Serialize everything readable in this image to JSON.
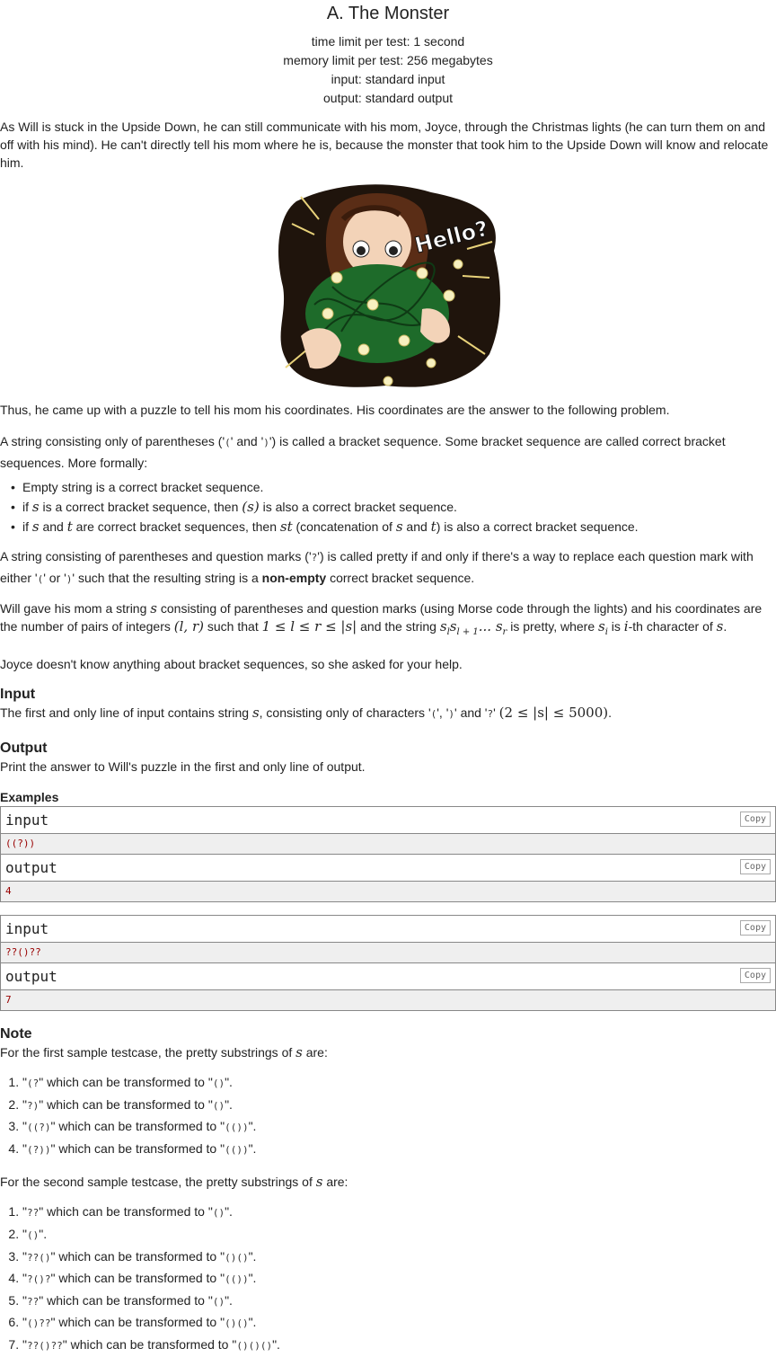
{
  "header": {
    "title": "A. The Monster",
    "time_limit": "time limit per test: 1 second",
    "memory_limit": "memory limit per test: 256 megabytes",
    "input": "input: standard input",
    "output": "output: standard output"
  },
  "statement": {
    "p1": "As Will is stuck in the Upside Down, he can still communicate with his mom, Joyce, through the Christmas lights (he can turn them on and off with his mind). He can't directly tell his mom where he is, because the monster that took him to the Upside Down will know and relocate him.",
    "image_text": "Hello?",
    "p2": "Thus, he came up with a puzzle to tell his mom his coordinates. His coordinates are the answer to the following problem.",
    "p3a": "A string consisting only of parentheses ('",
    "p3b": "' and '",
    "p3c": "') is called a bracket sequence. Some bracket sequence are called correct bracket sequences. More formally:",
    "paren_open": "(",
    "paren_close": ")",
    "b1": "Empty string is a correct bracket sequence.",
    "b2a": "if ",
    "b2b": " is a correct bracket sequence, then ",
    "b2c": " is also a correct bracket sequence.",
    "b3a": "if ",
    "b3b": " and ",
    "b3c": " are correct bracket sequences, then ",
    "b3d": " (concatenation of ",
    "b3e": " and ",
    "b3f": ") is also a correct bracket sequence.",
    "p4a": "A string consisting of parentheses and question marks ('",
    "p4b": "') is called pretty if and only if there's a way to replace each question mark with either '",
    "p4c": "' or '",
    "p4d": "' such that the resulting string is a ",
    "p4bold": "non-empty",
    "p4e": " correct bracket sequence.",
    "qmark": "?",
    "p5a": "Will gave his mom a string ",
    "p5b": " consisting of parentheses and question marks (using Morse code through the lights) and his coordinates are the number of pairs of integers ",
    "p5c": " such that ",
    "p5d": " and the string ",
    "p5e": " is pretty, where ",
    "p5f": " is ",
    "p5g": "-th character of ",
    "p5h": ".",
    "p6": "Joyce doesn't know anything about bracket sequences, so she asked for your help."
  },
  "math": {
    "s": "s",
    "t": "t",
    "st": "st",
    "i": "i",
    "paren_s": "(s)",
    "lr": "(l, r)",
    "ineq": "1 ≤ l ≤ r ≤ |s|",
    "substr": "s",
    "substr_sub1": "l",
    "substr_mid": "s",
    "substr_sub2": "l + 1",
    "substr_dots": "... s",
    "substr_sub3": "r",
    "si": "s",
    "si_sub": "i",
    "len_bound": "(2 ≤ |s| ≤ 5000)"
  },
  "input_section": {
    "title": "Input",
    "a": "The first and only line of input contains string ",
    "b": ", consisting only of characters '",
    "c": "', '",
    "d": "' and '",
    "e": "' ",
    "f": "."
  },
  "output_section": {
    "title": "Output",
    "text": "Print the answer to Will's puzzle in the first and only line of output."
  },
  "examples": {
    "title": "Examples",
    "input_label": "input",
    "output_label": "output",
    "copy_label": "Copy",
    "ex1_in": "((?))",
    "ex1_out": "4",
    "ex2_in": "??()??",
    "ex2_out": "7"
  },
  "note": {
    "title": "Note",
    "first_intro_a": "For the first sample testcase, the pretty substrings of ",
    "first_intro_b": " are:",
    "second_intro_a": "For the second sample testcase, the pretty substrings of ",
    "second_intro_b": " are:",
    "transform": "\" which can be transformed to \"",
    "first": [
      {
        "from": "(?",
        "to": "()"
      },
      {
        "from": "?)",
        "to": "()"
      },
      {
        "from": "((?)",
        "to": "(())"
      },
      {
        "from": "(?))",
        "to": "(())"
      }
    ],
    "second": [
      {
        "from": "??",
        "to": "()"
      },
      {
        "from": "()",
        "to": ""
      },
      {
        "from": "??()",
        "to": "()()"
      },
      {
        "from": "?()?",
        "to": "(())"
      },
      {
        "from": "??",
        "to": "()"
      },
      {
        "from": "()??",
        "to": "()()"
      },
      {
        "from": "??()??",
        "to": "()()()"
      }
    ]
  }
}
